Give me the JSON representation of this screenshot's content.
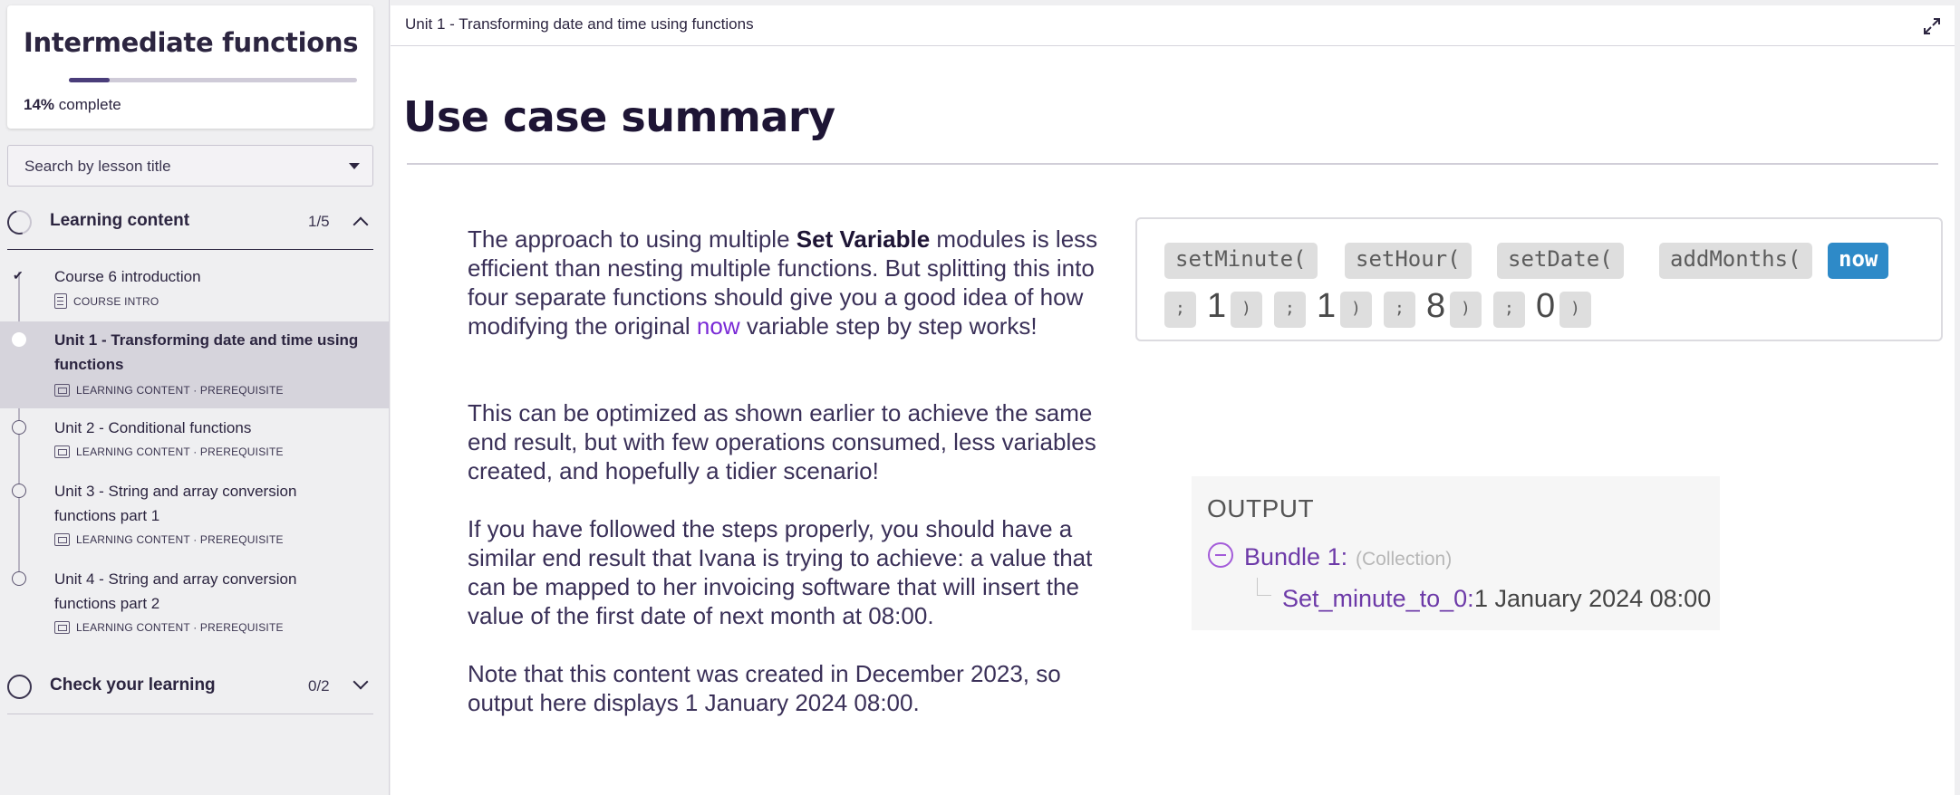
{
  "sidebar": {
    "course_title": "Intermediate functions",
    "progress_percent": "14%",
    "progress_suffix": "complete",
    "progress_fraction": 0.14,
    "search_placeholder": "Search by lesson title",
    "sections": [
      {
        "title": "Learning content",
        "count": "1/5",
        "expanded": true
      },
      {
        "title": "Check your learning",
        "count": "0/2",
        "expanded": false
      }
    ],
    "lessons": [
      {
        "name": "Course 6 introduction",
        "meta": "COURSE INTRO",
        "status": "completed"
      },
      {
        "name": "Unit 1 - Transforming date and time using functions",
        "meta": "LEARNING CONTENT · PREREQUISITE",
        "status": "active"
      },
      {
        "name": "Unit 2 - Conditional functions",
        "meta": "LEARNING CONTENT · PREREQUISITE",
        "status": "not-started"
      },
      {
        "name": "Unit 3 - String and array conversion functions part 1",
        "meta": "LEARNING CONTENT · PREREQUISITE",
        "status": "not-started"
      },
      {
        "name": "Unit 4 - String and array conversion functions part 2",
        "meta": "LEARNING CONTENT · PREREQUISITE",
        "status": "not-started"
      }
    ]
  },
  "main": {
    "breadcrumb": "Unit 1 - Transforming date and time using functions",
    "expand_icon": "expand-icon",
    "page_title": "Use case summary",
    "paragraphs": {
      "p1_before": "The approach to using multiple ",
      "p1_strong": "Set Variable",
      "p1_mid": " modules is less efficient than nesting multiple functions. But splitting this into four separate functions should give you a good idea of how modifying the original ",
      "p1_link": "now",
      "p1_after": " variable step by step works!",
      "p2": "This can be optimized as shown earlier to achieve the same end result, but with few operations consumed, less variables created, and hopefully a tidier scenario!",
      "p3": "If you have followed the steps properly, you should have a similar end result that Ivana is trying to achieve: a value that can be mapped to her invoicing software that will insert the value of the first date of next month at 08:00.",
      "p4": "Note that this content was created in December 2023, so output here displays 1 January 2024 08:00."
    },
    "code_chips": {
      "functions": [
        "setMinute(",
        "setHour(",
        "setDate(",
        "addMonths("
      ],
      "variable": "now",
      "separator": ";",
      "close": ")",
      "args": [
        "1",
        "1",
        "8",
        "0"
      ]
    },
    "output": {
      "heading": "OUTPUT",
      "bundle_label": "Bundle 1:",
      "bundle_type": "(Collection)",
      "key": "Set_minute_to_0:",
      "value": "1 January 2024 08:00"
    }
  },
  "colors": {
    "accent_purple": "#7a2ad6",
    "now_chip": "#2e8ac8",
    "heading": "#1e1535"
  }
}
